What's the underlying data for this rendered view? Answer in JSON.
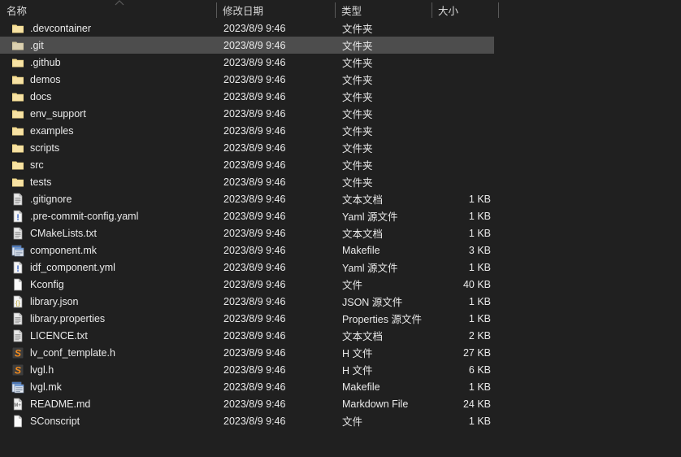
{
  "window": {
    "kind": "file-explorer-list-view",
    "background_color": "#202020",
    "selection_color": "#4d4d4d",
    "text_color": "#eaeaea"
  },
  "header": {
    "sort_indicator_icon": "chevron-up-icon",
    "columns": [
      {
        "key": "name",
        "label": "名称"
      },
      {
        "key": "date",
        "label": "修改日期"
      },
      {
        "key": "type",
        "label": "类型"
      },
      {
        "key": "size",
        "label": "大小"
      }
    ]
  },
  "files": [
    {
      "icon": "folder-icon",
      "name": ".devcontainer",
      "date": "2023/8/9 9:46",
      "type": "文件夹",
      "size": "",
      "selected": false
    },
    {
      "icon": "folder-icon",
      "name": ".git",
      "date": "2023/8/9 9:46",
      "type": "文件夹",
      "size": "",
      "selected": true
    },
    {
      "icon": "folder-icon",
      "name": ".github",
      "date": "2023/8/9 9:46",
      "type": "文件夹",
      "size": "",
      "selected": false
    },
    {
      "icon": "folder-icon",
      "name": "demos",
      "date": "2023/8/9 9:46",
      "type": "文件夹",
      "size": "",
      "selected": false
    },
    {
      "icon": "folder-icon",
      "name": "docs",
      "date": "2023/8/9 9:46",
      "type": "文件夹",
      "size": "",
      "selected": false
    },
    {
      "icon": "folder-icon",
      "name": "env_support",
      "date": "2023/8/9 9:46",
      "type": "文件夹",
      "size": "",
      "selected": false
    },
    {
      "icon": "folder-icon",
      "name": "examples",
      "date": "2023/8/9 9:46",
      "type": "文件夹",
      "size": "",
      "selected": false
    },
    {
      "icon": "folder-icon",
      "name": "scripts",
      "date": "2023/8/9 9:46",
      "type": "文件夹",
      "size": "",
      "selected": false
    },
    {
      "icon": "folder-icon",
      "name": "src",
      "date": "2023/8/9 9:46",
      "type": "文件夹",
      "size": "",
      "selected": false
    },
    {
      "icon": "folder-icon",
      "name": "tests",
      "date": "2023/8/9 9:46",
      "type": "文件夹",
      "size": "",
      "selected": false
    },
    {
      "icon": "text-document-icon",
      "name": ".gitignore",
      "date": "2023/8/9 9:46",
      "type": "文本文档",
      "size": "1 KB",
      "selected": false
    },
    {
      "icon": "yaml-file-icon",
      "name": ".pre-commit-config.yaml",
      "date": "2023/8/9 9:46",
      "type": "Yaml 源文件",
      "size": "1 KB",
      "selected": false
    },
    {
      "icon": "text-document-icon",
      "name": "CMakeLists.txt",
      "date": "2023/8/9 9:46",
      "type": "文本文档",
      "size": "1 KB",
      "selected": false
    },
    {
      "icon": "makefile-icon",
      "name": "component.mk",
      "date": "2023/8/9 9:46",
      "type": "Makefile",
      "size": "3 KB",
      "selected": false
    },
    {
      "icon": "yaml-file-icon",
      "name": "idf_component.yml",
      "date": "2023/8/9 9:46",
      "type": "Yaml 源文件",
      "size": "1 KB",
      "selected": false
    },
    {
      "icon": "blank-file-icon",
      "name": "Kconfig",
      "date": "2023/8/9 9:46",
      "type": "文件",
      "size": "40 KB",
      "selected": false
    },
    {
      "icon": "json-file-icon",
      "name": "library.json",
      "date": "2023/8/9 9:46",
      "type": "JSON 源文件",
      "size": "1 KB",
      "selected": false
    },
    {
      "icon": "text-document-icon",
      "name": "library.properties",
      "date": "2023/8/9 9:46",
      "type": "Properties 源文件",
      "size": "1 KB",
      "selected": false
    },
    {
      "icon": "text-document-icon",
      "name": "LICENCE.txt",
      "date": "2023/8/9 9:46",
      "type": "文本文档",
      "size": "2 KB",
      "selected": false
    },
    {
      "icon": "header-file-icon",
      "name": "lv_conf_template.h",
      "date": "2023/8/9 9:46",
      "type": "H 文件",
      "size": "27 KB",
      "selected": false
    },
    {
      "icon": "header-file-icon",
      "name": "lvgl.h",
      "date": "2023/8/9 9:46",
      "type": "H 文件",
      "size": "6 KB",
      "selected": false
    },
    {
      "icon": "makefile-icon",
      "name": "lvgl.mk",
      "date": "2023/8/9 9:46",
      "type": "Makefile",
      "size": "1 KB",
      "selected": false
    },
    {
      "icon": "markdown-file-icon",
      "name": "README.md",
      "date": "2023/8/9 9:46",
      "type": "Markdown File",
      "size": "24 KB",
      "selected": false
    },
    {
      "icon": "blank-file-icon",
      "name": "SConscript",
      "date": "2023/8/9 9:46",
      "type": "文件",
      "size": "1 KB",
      "selected": false
    }
  ]
}
